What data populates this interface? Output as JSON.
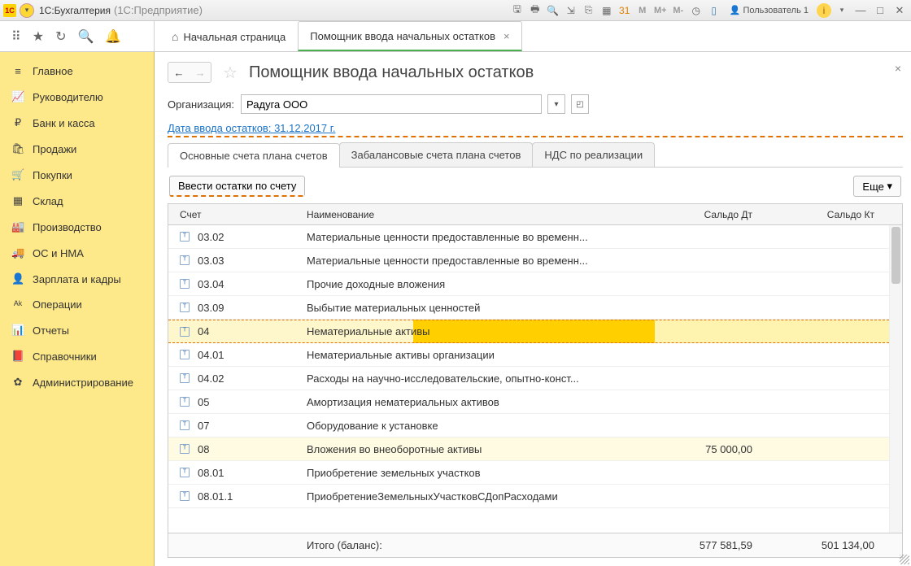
{
  "titlebar": {
    "app_short": "1C",
    "title": "1С:Бухгалтерия",
    "subtitle": "(1С:Предприятие)",
    "m1": "M",
    "m2": "M+",
    "m3": "M-",
    "user_label": "Пользователь 1"
  },
  "main_tabs": {
    "home": "Начальная страница",
    "active": "Помощник ввода начальных остатков"
  },
  "sidebar": [
    {
      "icon": "≡",
      "label": "Главное"
    },
    {
      "icon": "📈",
      "label": "Руководителю"
    },
    {
      "icon": "₽",
      "label": "Банк и касса"
    },
    {
      "icon": "🛍",
      "label": "Продажи"
    },
    {
      "icon": "🛒",
      "label": "Покупки"
    },
    {
      "icon": "▦",
      "label": "Склад"
    },
    {
      "icon": "🏭",
      "label": "Производство"
    },
    {
      "icon": "🚚",
      "label": "ОС и НМА"
    },
    {
      "icon": "👤",
      "label": "Зарплата и кадры"
    },
    {
      "icon": "ᴬᵏ",
      "label": "Операции"
    },
    {
      "icon": "📊",
      "label": "Отчеты"
    },
    {
      "icon": "📕",
      "label": "Справочники"
    },
    {
      "icon": "✿",
      "label": "Администрирование"
    }
  ],
  "page": {
    "title": "Помощник ввода начальных остатков",
    "org_label": "Организация:",
    "org_value": "Радуга ООО",
    "date_link": "Дата ввода остатков: 31.12.2017 г.",
    "sub_tabs": [
      "Основные счета плана счетов",
      "Забалансовые счета плана счетов",
      "НДС по реализации"
    ],
    "enter_btn": "Ввести остатки по счету",
    "more_btn": "Еще",
    "columns": {
      "acct": "Счет",
      "name": "Наименование",
      "dt": "Сальдо Дт",
      "kt": "Сальдо Кт"
    },
    "rows": [
      {
        "acct": "03.02",
        "name": "Материальные ценности предоставленные во временн...",
        "dt": "",
        "kt": ""
      },
      {
        "acct": "03.03",
        "name": "Материальные ценности предоставленные во временн...",
        "dt": "",
        "kt": ""
      },
      {
        "acct": "03.04",
        "name": "Прочие доходные вложения",
        "dt": "",
        "kt": ""
      },
      {
        "acct": "03.09",
        "name": "Выбытие материальных ценностей",
        "dt": "",
        "kt": ""
      },
      {
        "acct": "04",
        "name": "Нематериальные активы",
        "dt": "",
        "kt": "",
        "selected": true
      },
      {
        "acct": "04.01",
        "name": "Нематериальные активы организации",
        "dt": "",
        "kt": ""
      },
      {
        "acct": "04.02",
        "name": "Расходы на научно-исследовательские, опытно-конст...",
        "dt": "",
        "kt": ""
      },
      {
        "acct": "05",
        "name": "Амортизация нематериальных активов",
        "dt": "",
        "kt": ""
      },
      {
        "acct": "07",
        "name": "Оборудование к установке",
        "dt": "",
        "kt": ""
      },
      {
        "acct": "08",
        "name": "Вложения во внеоборотные активы",
        "dt": "75 000,00",
        "kt": "",
        "light": true
      },
      {
        "acct": "08.01",
        "name": "Приобретение земельных участков",
        "dt": "",
        "kt": ""
      },
      {
        "acct": "08.01.1",
        "name": "ПриобретениеЗемельныхУчастковСДопРасходами",
        "dt": "",
        "kt": ""
      }
    ],
    "footer": {
      "label": "Итого (баланс):",
      "dt": "577 581,59",
      "kt": "501 134,00"
    }
  }
}
